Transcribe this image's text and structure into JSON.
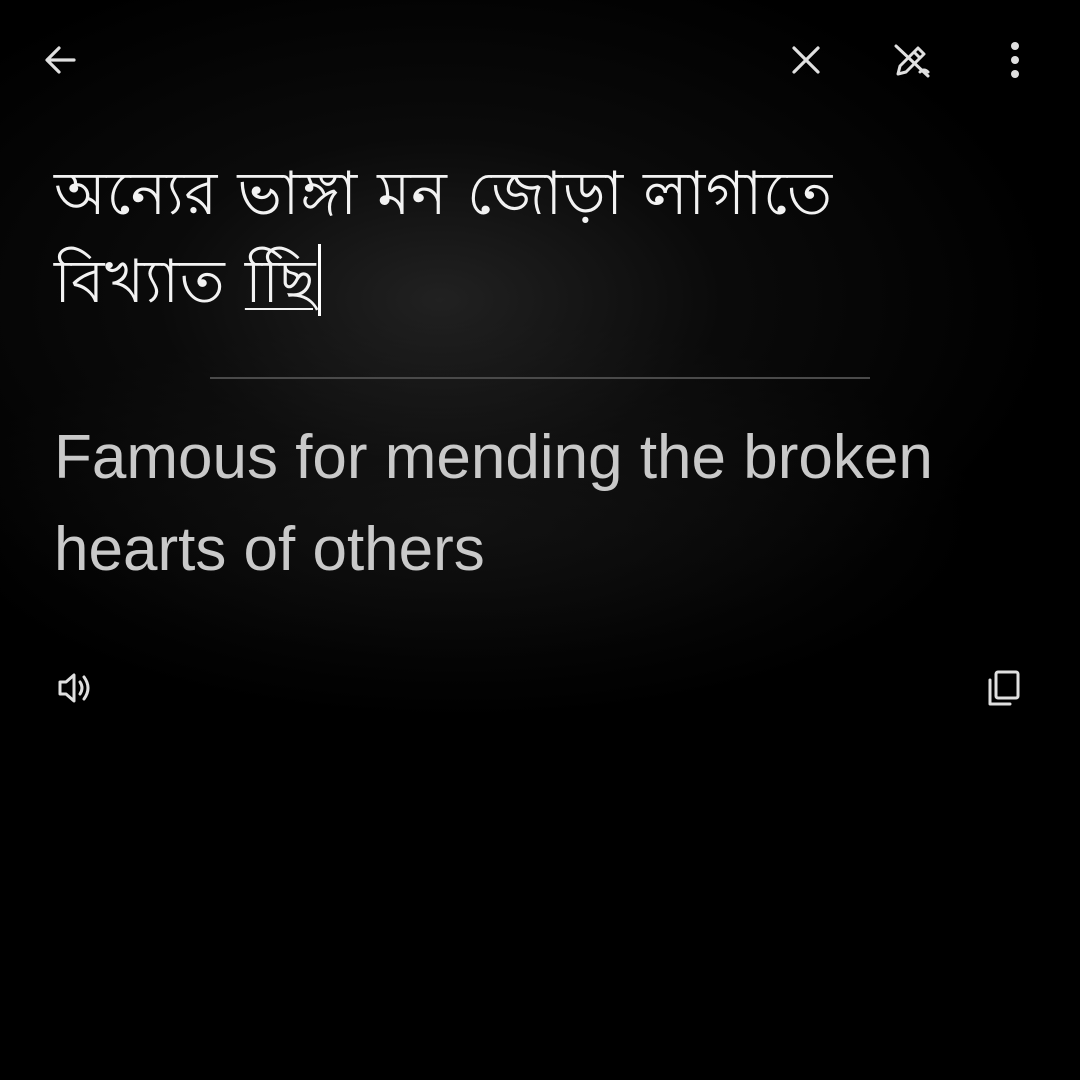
{
  "toolbar": {
    "back_icon": "arrow-left-icon",
    "close_icon": "close-icon",
    "edit_icon": "edit-pencil-off-icon",
    "more_icon": "more-vertical-icon"
  },
  "source": {
    "text_main": "অন্যের ভাঙ্গা মন জোড়া লাগাতে বিখ্যাত ",
    "text_last": "ছিি"
  },
  "translation": {
    "text": "Famous for mending the broken hearts of others"
  },
  "actions": {
    "speak_icon": "speaker-icon",
    "copy_icon": "copy-icon"
  },
  "colors": {
    "background": "#000000",
    "source_text": "#f2f2f2",
    "translation_text": "#c9c9c9",
    "divider": "#4a4a4a"
  }
}
